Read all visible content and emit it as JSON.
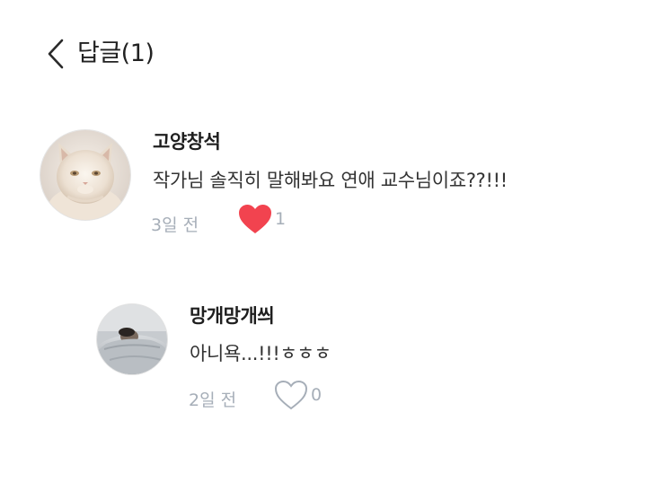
{
  "header": {
    "title": "답글(1)",
    "back_icon": "chevron-left-icon"
  },
  "comment": {
    "author": "고양창석",
    "text": "작가님 솔직히 말해봐요 연애 교수님이죠??!!!",
    "time": "3일 전",
    "likes": "1",
    "liked": true,
    "like_color": "#f2434f",
    "avatar": "cat-avatar"
  },
  "reply": {
    "author": "망개망개씌",
    "text": "아니욕...!!!ㅎㅎㅎ",
    "time": "2일 전",
    "likes": "0",
    "liked": false,
    "like_color": "#a6aeb8",
    "avatar": "sleeping-person-avatar"
  }
}
